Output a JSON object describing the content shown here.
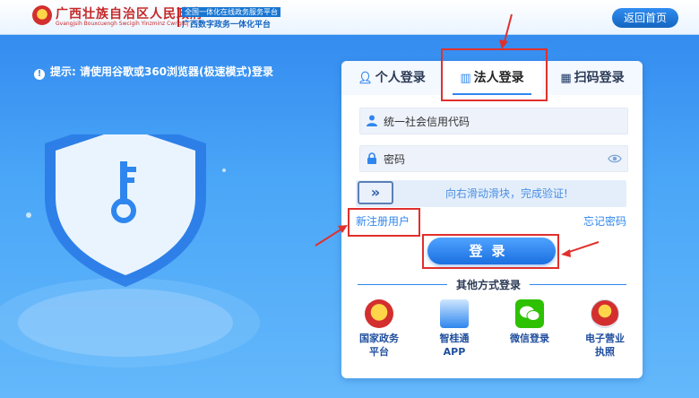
{
  "header": {
    "title": "广西壮族自治区人民政府",
    "title_pinyin": "Gvangjsih Bouxcuengh Swcigih Yinzminz Cwngfuj",
    "badge_top": "全国一体化在线政务服务平台",
    "badge_bottom": "广西数字政务一体化平台",
    "back_label": "返回首页"
  },
  "tip": "提示: 请使用谷歌或360浏览器(极速模式)登录",
  "tabs": [
    {
      "label": "个人登录",
      "icon": "person-icon"
    },
    {
      "label": "法人登录",
      "icon": "building-icon"
    },
    {
      "label": "扫码登录",
      "icon": "qr-icon"
    }
  ],
  "active_tab": "法人登录",
  "form": {
    "credit_code_placeholder": "统一社会信用代码",
    "password_placeholder": "密码",
    "slider_handle": "»",
    "slider_text": "向右滑动滑块，完成验证!",
    "register_label": "新注册用户",
    "forgot_label": "忘记密码",
    "login_label": "登录"
  },
  "other_title": "其他方式登录",
  "other_methods": [
    {
      "label": "国家政务平台",
      "icon": "national-emblem-icon"
    },
    {
      "label": "智桂通APP",
      "icon": "zhiguitong-icon"
    },
    {
      "label": "微信登录",
      "icon": "wechat-icon"
    },
    {
      "label": "电子营业执照",
      "icon": "business-license-icon"
    }
  ],
  "colors": {
    "primary": "#2f86ee",
    "annotation": "#e0302d",
    "gov_red": "#c62828"
  }
}
